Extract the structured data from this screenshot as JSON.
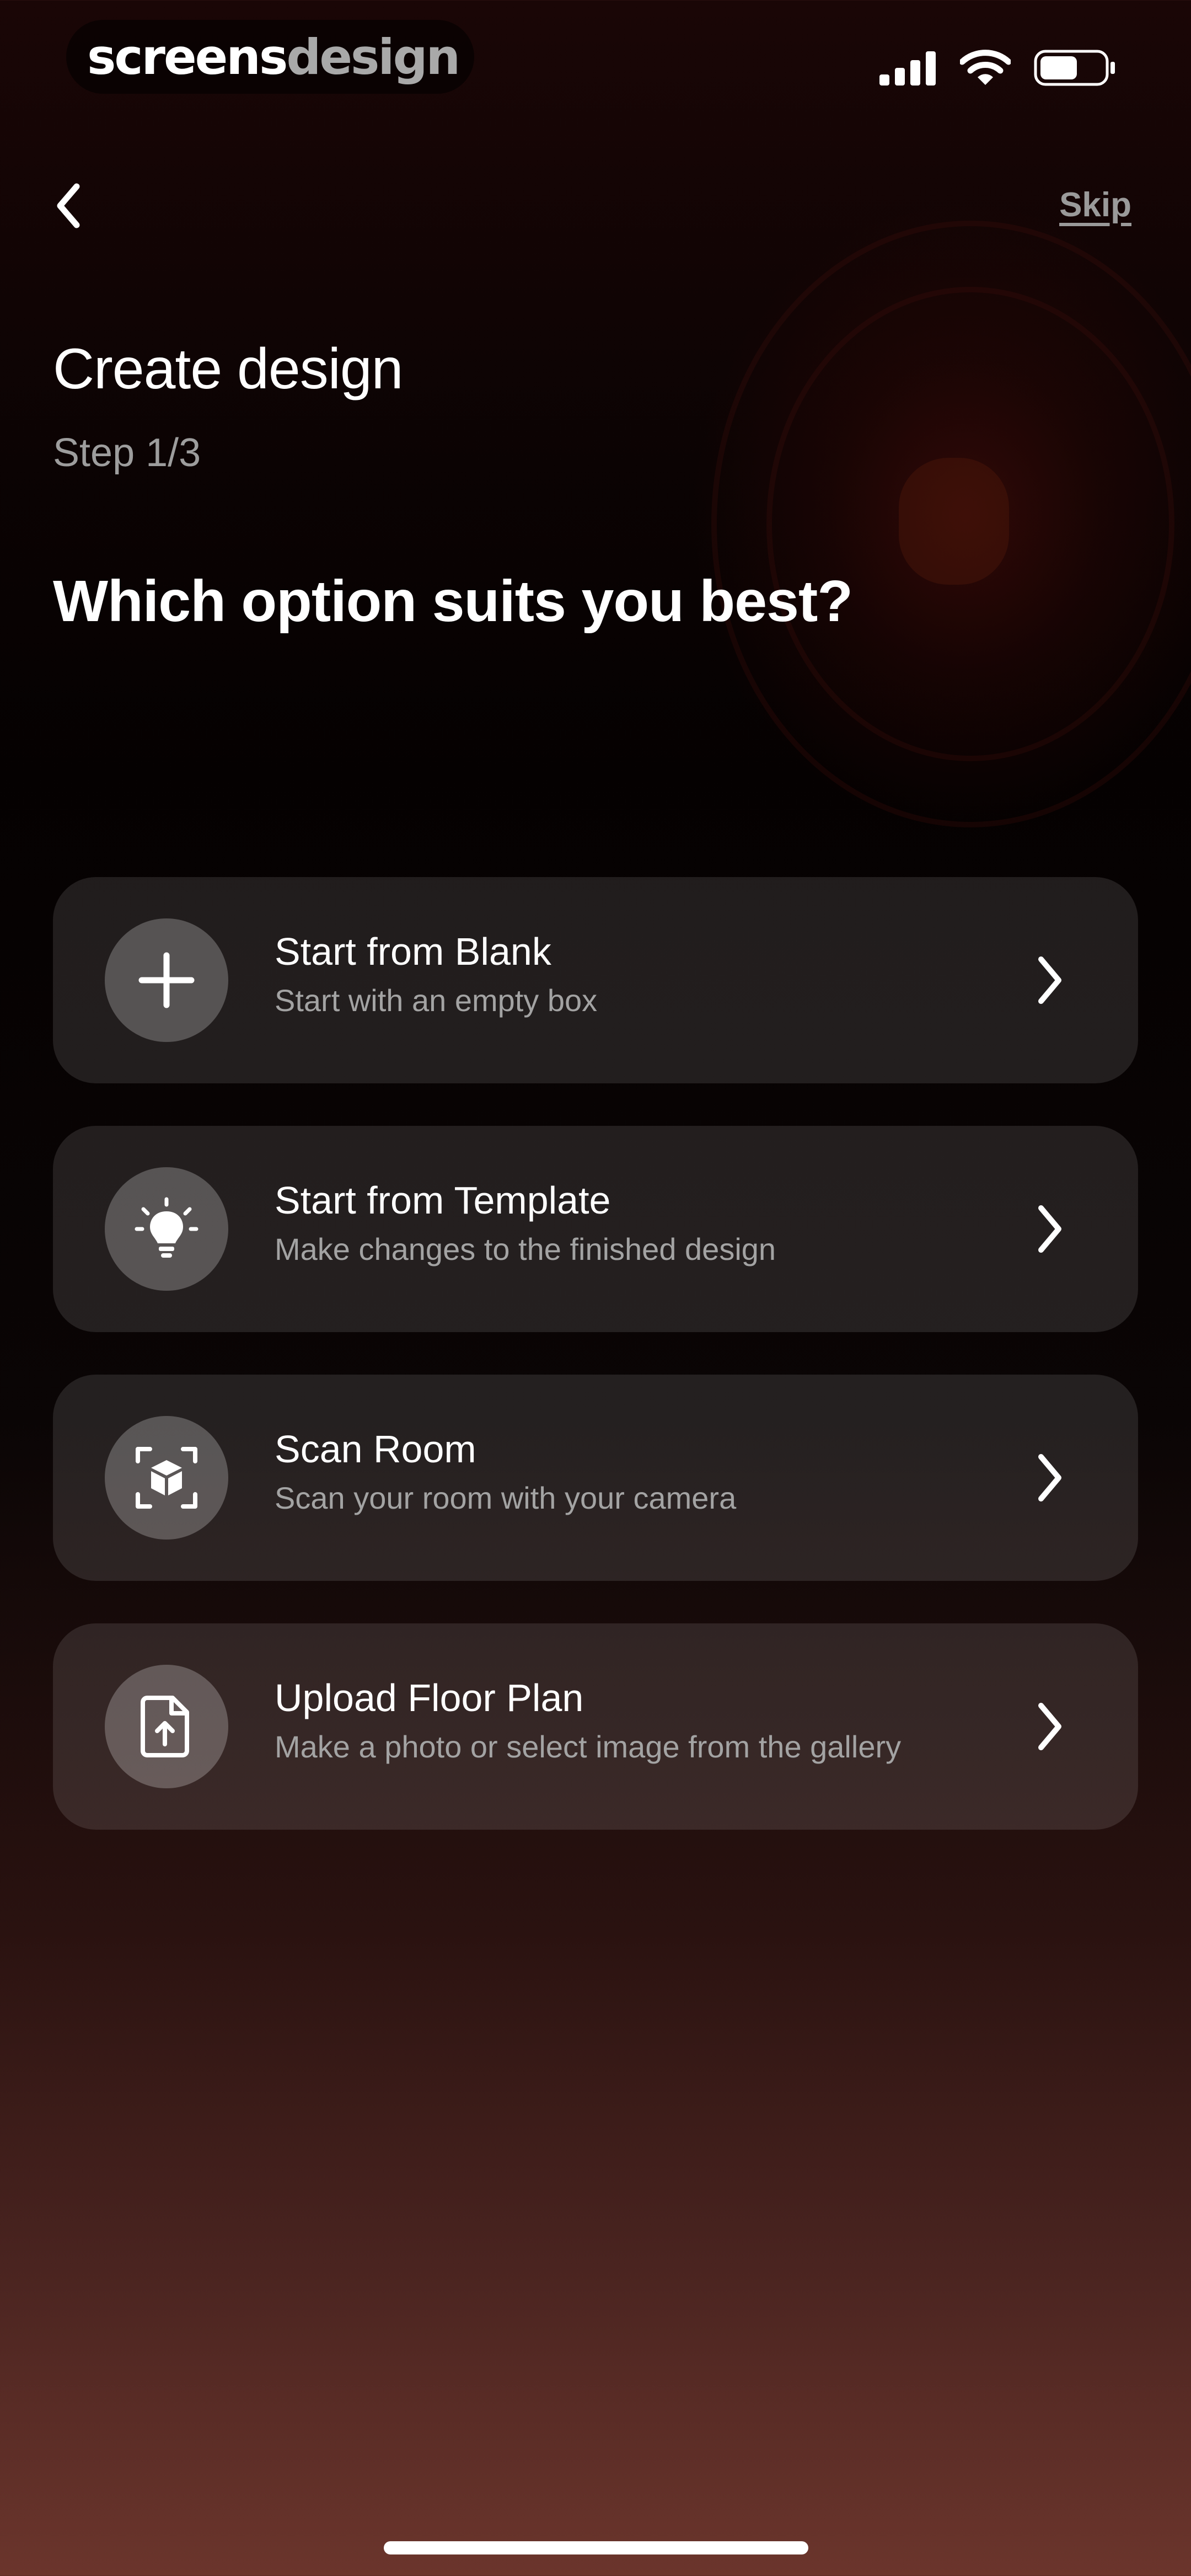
{
  "status_bar": {
    "brand_part1": "screens",
    "brand_part2": "design",
    "signal_icon": "signal-icon",
    "wifi_icon": "wifi-icon",
    "battery_icon": "battery-icon"
  },
  "nav": {
    "back_icon": "chevron-left-icon",
    "skip_label": "Skip"
  },
  "header": {
    "title": "Create design",
    "step": "Step 1/3",
    "question": "Which option suits you best?"
  },
  "options": [
    {
      "title": "Start from Blank",
      "subtitle": "Start with an empty box",
      "icon": "plus-icon"
    },
    {
      "title": "Start from Template",
      "subtitle": "Make changes to the finished design",
      "icon": "lightbulb-icon"
    },
    {
      "title": "Scan Room",
      "subtitle": "Scan your room with your camera",
      "icon": "scan-cube-icon"
    },
    {
      "title": "Upload Floor Plan",
      "subtitle": "Make a photo or select image from the gallery",
      "icon": "file-upload-icon"
    }
  ],
  "colors": {
    "accent_text": "#ffffff",
    "muted_text": "#9d9d9d",
    "card_bg": "#2a2424",
    "bottom_gradient": "#6b352c"
  }
}
